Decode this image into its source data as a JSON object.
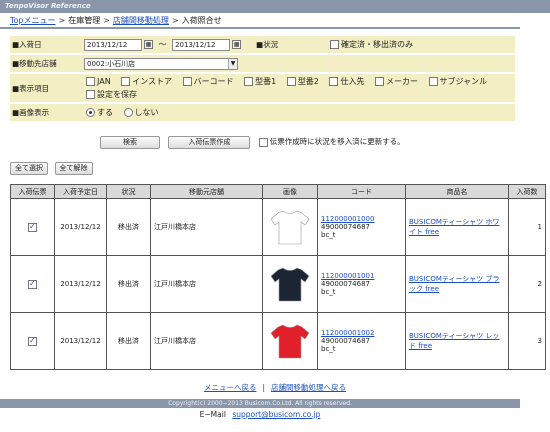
{
  "app": {
    "title": "TenpoVisor Reference"
  },
  "breadcrumb": {
    "top": "Topメニュー",
    "inventory": "在庫管理",
    "transfer": "店舗間移動処理",
    "current": "入荷照合せ"
  },
  "form": {
    "date_label": "■入荷日",
    "date_from": "2013/12/12",
    "date_sep": "〜",
    "date_to": "2013/12/12",
    "status_label": "■状況",
    "status_option": "確定済・移出済のみ",
    "dest_label": "■移動先店舗",
    "dest_value": "0002:小石川店",
    "display_label": "■表示項目",
    "display_items": [
      "JAN",
      "インストア",
      "バーコード",
      "型番1",
      "型番2",
      "仕入先",
      "メーカー",
      "サブジャンル"
    ],
    "save_setting": "設定を保存",
    "image_label": "■画像表示",
    "image_yes": "する",
    "image_no": "しない"
  },
  "actions": {
    "search": "検索",
    "create": "入荷伝票作成",
    "update_note": "伝票作成時に状況を移入済に更新する。"
  },
  "bulk": {
    "select_all": "全て選択",
    "clear_all": "全て解除"
  },
  "table": {
    "headers": [
      "入荷伝票",
      "入荷予定日",
      "状況",
      "移動元店舗",
      "画像",
      "コード",
      "商品名",
      "入荷数"
    ],
    "rows": [
      {
        "date": "2013/12/12",
        "status": "移出済",
        "origin": "江戸川橋本店",
        "code1": "112000001000",
        "code2": "49000074687",
        "code3": "bc_t",
        "name": "BUSICOMティーシャツ ホワイト free",
        "qty": "1",
        "shirt_color": "#ffffff"
      },
      {
        "date": "2013/12/12",
        "status": "移出済",
        "origin": "江戸川橋本店",
        "code1": "112000001001",
        "code2": "49000074687",
        "code3": "bc_t",
        "name": "BUSICOMティーシャツ ブラック free",
        "qty": "2",
        "shirt_color": "#1c2533"
      },
      {
        "date": "2013/12/12",
        "status": "移出済",
        "origin": "江戸川橋本店",
        "code1": "112000001002",
        "code2": "49000074687",
        "code3": "bc_t",
        "name": "BUSICOMティーシャツ レッド free",
        "qty": "3",
        "shirt_color": "#e0202a"
      }
    ]
  },
  "footer": {
    "menu_link": "メニューへ戻る",
    "sep": "|",
    "transfer_link": "店舗間移動処理へ戻る",
    "copyright": "Copyright(c) 2000−2013 Busicom.Co.Ltd. All rights reserved.",
    "email_label": "E−Mail",
    "email": "support@busicom.co.jp"
  }
}
